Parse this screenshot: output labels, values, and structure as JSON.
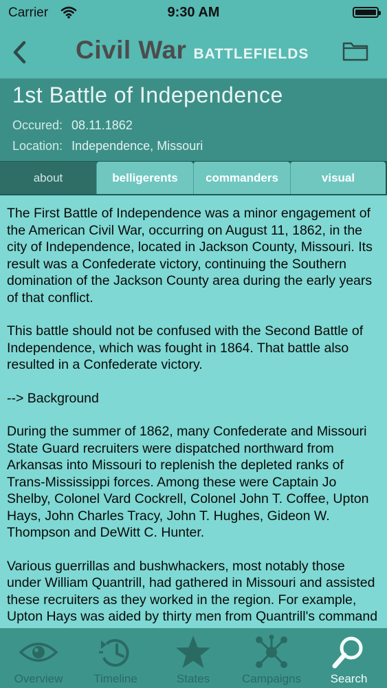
{
  "status": {
    "carrier": "Carrier",
    "time": "9:30 AM"
  },
  "nav": {
    "brand_main": "Civil War",
    "brand_sub": "BATTLEFIELDS"
  },
  "battle": {
    "title": "1st Battle of Independence",
    "occurred_label": "Occured:",
    "occurred_value": "08.11.1862",
    "location_label": "Location:",
    "location_value": "Independence, Missouri"
  },
  "tabs": [
    {
      "label": "about"
    },
    {
      "label": "belligerents"
    },
    {
      "label": "commanders"
    },
    {
      "label": "visual"
    }
  ],
  "article": {
    "p1": "The First Battle of Independence was a minor engagement of the American Civil War, occurring on August 11, 1862, in the city of Independence, located in Jackson County, Missouri.  Its result was a Confederate victory, continuing the Southern domination of the Jackson County area during the early years of that conflict.",
    "p2": "This battle should not be confused with the Second Battle of Independence, which was fought in 1864.  That battle also resulted in a Confederate victory.",
    "p3": "--> Background",
    "p4": "During the summer of 1862, many Confederate and Missouri State Guard recruiters were dispatched northward from Arkansas into Missouri to replenish the depleted ranks of Trans-Mississippi forces. Among these were Captain Jo Shelby, Colonel Vard Cockrell, Colonel John T. Coffee, Upton Hays, John Charles Tracy, John T. Hughes, Gideon W. Thompson and DeWitt C. Hunter.",
    "p5": "Various guerrillas and bushwhackers, most notably those under William Quantrill, had gathered in Missouri and assisted these recruiters as they worked in the region.  For example, Upton Hays was aided by thirty men from Quantrill's command under the leadership of George Todd. By"
  },
  "tabbar": [
    {
      "label": "Overview",
      "icon": "eye-icon"
    },
    {
      "label": "Timeline",
      "icon": "timeline-clock-icon"
    },
    {
      "label": "States",
      "icon": "star-icon"
    },
    {
      "label": "Campaigns",
      "icon": "network-icon"
    },
    {
      "label": "Search",
      "icon": "search-icon"
    }
  ],
  "colors": {
    "status_bg": "#57bab3",
    "header_bg": "#3c8f87",
    "content_bg": "#7fd8d3",
    "tabbar_bg": "#3d948b",
    "tabbar_icon": "#2a6a63",
    "tabbar_active": "#f4fbfa"
  }
}
